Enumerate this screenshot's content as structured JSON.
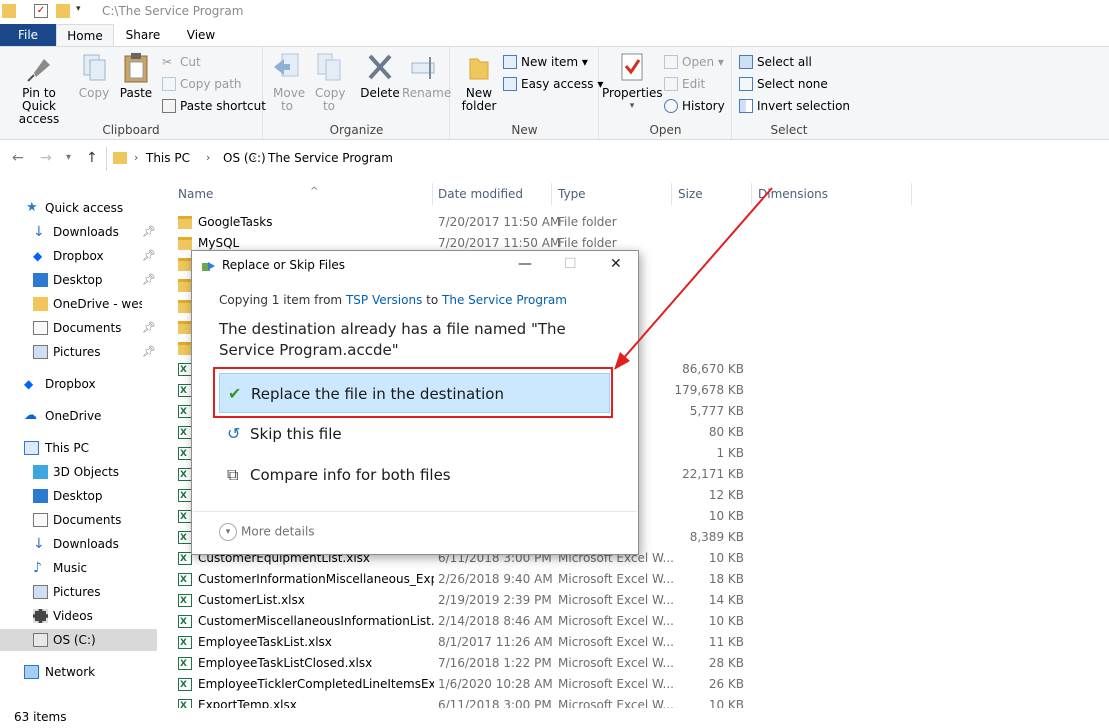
{
  "window": {
    "path_title": "C:\\The Service Program"
  },
  "tabs": {
    "file": "File",
    "home": "Home",
    "share": "Share",
    "view": "View"
  },
  "ribbon": {
    "clipboard": {
      "label": "Clipboard",
      "pin": "Pin to Quick access",
      "copy": "Copy",
      "paste": "Paste",
      "cut": "Cut",
      "copy_path": "Copy path",
      "paste_shortcut": "Paste shortcut"
    },
    "organize": {
      "label": "Organize",
      "move_to": "Move to",
      "copy_to": "Copy to",
      "delete": "Delete",
      "rename": "Rename"
    },
    "new": {
      "label": "New",
      "new_folder": "New folder",
      "new_item": "New item",
      "easy_access": "Easy access"
    },
    "open": {
      "label": "Open",
      "properties": "Properties",
      "open": "Open",
      "edit": "Edit",
      "history": "History"
    },
    "select": {
      "label": "Select",
      "select_all": "Select all",
      "select_none": "Select none",
      "invert": "Invert selection"
    }
  },
  "address": {
    "crumbs": [
      "This PC",
      "OS (C:)",
      "The Service Program"
    ]
  },
  "nav": {
    "quick_access": "Quick access",
    "qa_items": [
      "Downloads",
      "Dropbox",
      "Desktop",
      "OneDrive - westr",
      "Documents",
      "Pictures"
    ],
    "dropbox": "Dropbox",
    "onedrive": "OneDrive",
    "this_pc": "This PC",
    "pc_items": [
      "3D Objects",
      "Desktop",
      "Documents",
      "Downloads",
      "Music",
      "Pictures",
      "Videos",
      "OS (C:)"
    ],
    "network": "Network"
  },
  "columns": {
    "name": "Name",
    "date": "Date modified",
    "type": "Type",
    "size": "Size",
    "dimensions": "Dimensions"
  },
  "files": [
    {
      "name": "GoogleTasks",
      "date": "7/20/2017 11:50 AM",
      "type": "File folder",
      "size": ""
    },
    {
      "name": "MySQL",
      "date": "7/20/2017 11:50 AM",
      "type": "File folder",
      "size": ""
    },
    {
      "name": "",
      "date": "",
      "type": "",
      "size": ""
    },
    {
      "name": "",
      "date": "",
      "type": "",
      "size": ""
    },
    {
      "name": "",
      "date": "",
      "type": "",
      "size": ""
    },
    {
      "name": "",
      "date": "",
      "type": "",
      "size": ""
    },
    {
      "name": "",
      "date": "",
      "type": "",
      "size": ""
    },
    {
      "name": "",
      "date": "",
      "type": "",
      "size": "86,670 KB"
    },
    {
      "name": "",
      "date": "",
      "type": "",
      "size": "179,678 KB"
    },
    {
      "name": "",
      "date": "",
      "type": "",
      "size": "5,777 KB"
    },
    {
      "name": "",
      "date": "",
      "type": "",
      "size": "80 KB"
    },
    {
      "name": "",
      "date": "",
      "type": "",
      "size": "1 KB"
    },
    {
      "name": "",
      "date": "",
      "type": "pp...",
      "size": "22,171 KB"
    },
    {
      "name": "",
      "date": "",
      "type": "W...",
      "size": "12 KB"
    },
    {
      "name": "",
      "date": "",
      "type": "W...",
      "size": "10 KB"
    },
    {
      "name": "",
      "date": "",
      "type": "",
      "size": "8,389 KB"
    },
    {
      "name": "CustomerEquipmentList.xlsx",
      "date": "6/11/2018 3:00 PM",
      "type": "Microsoft Excel W...",
      "size": "10 KB"
    },
    {
      "name": "CustomerInformationMiscellaneous_Exp...",
      "date": "2/26/2018 9:40 AM",
      "type": "Microsoft Excel W...",
      "size": "18 KB"
    },
    {
      "name": "CustomerList.xlsx",
      "date": "2/19/2019 2:39 PM",
      "type": "Microsoft Excel W...",
      "size": "14 KB"
    },
    {
      "name": "CustomerMiscellaneousInformationList.x...",
      "date": "2/14/2018 8:46 AM",
      "type": "Microsoft Excel W...",
      "size": "10 KB"
    },
    {
      "name": "EmployeeTaskList.xlsx",
      "date": "8/1/2017 11:26 AM",
      "type": "Microsoft Excel W...",
      "size": "11 KB"
    },
    {
      "name": "EmployeeTaskListClosed.xlsx",
      "date": "7/16/2018 1:22 PM",
      "type": "Microsoft Excel W...",
      "size": "28 KB"
    },
    {
      "name": "EmployeeTicklerCompletedLineItemsExp...",
      "date": "1/6/2020 10:28 AM",
      "type": "Microsoft Excel W...",
      "size": "26 KB"
    },
    {
      "name": "ExportTemp.xlsx",
      "date": "6/11/2018 3:00 PM",
      "type": "Microsoft Excel W...",
      "size": "10 KB"
    }
  ],
  "status": {
    "items": "63 items"
  },
  "dialog": {
    "title": "Replace or Skip Files",
    "copy_prefix": "Copying 1 item from",
    "source": "TSP Versions",
    "copy_to": "to",
    "destination": "The Service Program",
    "message": "The destination already has a file named \"The Service Program.accde\"",
    "replace": "Replace the file in the destination",
    "skip": "Skip this file",
    "compare": "Compare info for both files",
    "more_details": "More details"
  },
  "colors": {
    "accent": "#19478a",
    "highlight": "#cce8ff",
    "annotation": "#e01f1f"
  }
}
